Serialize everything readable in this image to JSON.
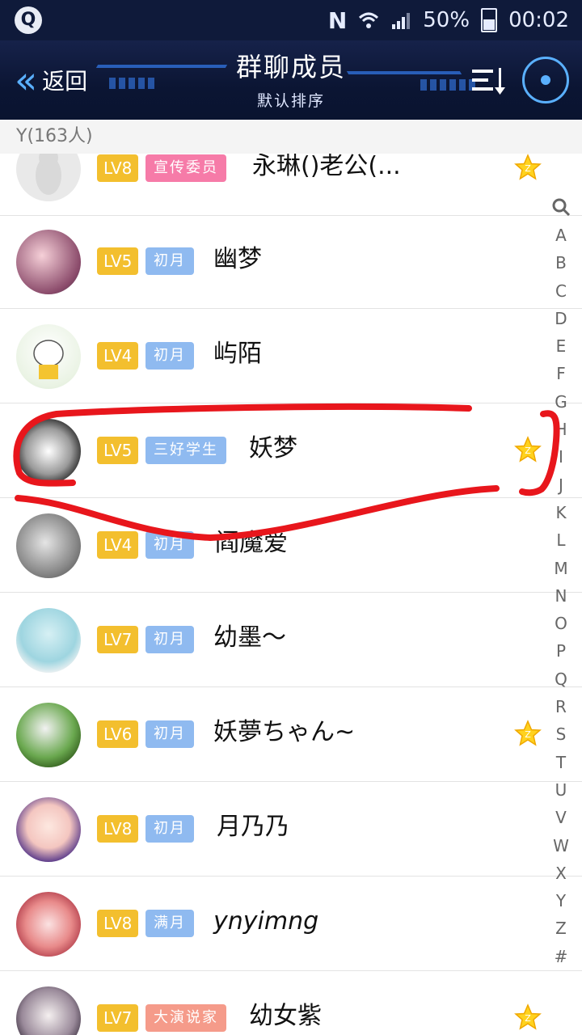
{
  "status_bar": {
    "time": "00:02",
    "battery": "50%",
    "nfc": "N"
  },
  "header": {
    "back_label": "返回",
    "title": "群聊成员",
    "subtitle": "默认排序"
  },
  "section": {
    "label": "Y(163人)"
  },
  "members": [
    {
      "level": "LV8",
      "tag": "宣传委员",
      "tag_color": "#f67ba8",
      "name": "永琳()老公(...",
      "star": true
    },
    {
      "level": "LV5",
      "tag": "初月",
      "tag_color": "#8fbaf0",
      "name": "幽梦",
      "star": false
    },
    {
      "level": "LV4",
      "tag": "初月",
      "tag_color": "#8fbaf0",
      "name": "屿陌",
      "star": false
    },
    {
      "level": "LV5",
      "tag": "三好学生",
      "tag_color": "#8fbaf0",
      "name": "妖梦",
      "star": true
    },
    {
      "level": "LV4",
      "tag": "初月",
      "tag_color": "#8fbaf0",
      "name": "阎魔爱",
      "star": false
    },
    {
      "level": "LV7",
      "tag": "初月",
      "tag_color": "#8fbaf0",
      "name": "幼墨～",
      "star": false
    },
    {
      "level": "LV6",
      "tag": "初月",
      "tag_color": "#8fbaf0",
      "name": "妖夢ちゃん~",
      "star": true
    },
    {
      "level": "LV8",
      "tag": "初月",
      "tag_color": "#8fbaf0",
      "name": "月乃乃",
      "star": false
    },
    {
      "level": "LV8",
      "tag": "满月",
      "tag_color": "#8fbaf0",
      "name": "ynyimng",
      "star": false
    },
    {
      "level": "LV7",
      "tag": "大演说家",
      "tag_color": "#f59b8a",
      "name": "幼女紫",
      "star": true
    }
  ],
  "index_letters": [
    "A",
    "B",
    "C",
    "D",
    "E",
    "F",
    "G",
    "H",
    "I",
    "J",
    "K",
    "L",
    "M",
    "N",
    "O",
    "P",
    "Q",
    "R",
    "S",
    "T",
    "U",
    "V",
    "W",
    "X",
    "Y",
    "Z",
    "#"
  ],
  "colors": {
    "accent": "#5ab0ff",
    "level_badge": "#f3bf2e",
    "header_bg": "#0b1533",
    "annotation": "#e8161c"
  }
}
